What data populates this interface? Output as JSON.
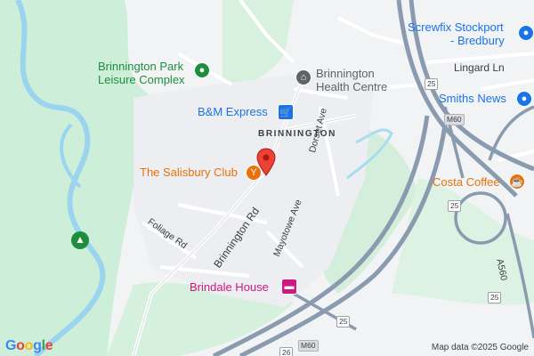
{
  "map": {
    "pois": {
      "brinnington_park": {
        "line1": "Brinnington Park",
        "line2": "Leisure Complex",
        "icon": "leisure-icon"
      },
      "health_centre": {
        "line1": "Brinnington",
        "line2": "Health Centre",
        "icon": "hospital-icon"
      },
      "bm_express": {
        "label": "B&M Express",
        "icon": "shopping-cart-icon"
      },
      "salisbury_club": {
        "label": "The Salisbury Club",
        "icon": "cocktail-icon"
      },
      "screwfix": {
        "line1": "Screwfix Stockport",
        "line2": "- Bredbury",
        "icon": "shopping-bag-icon"
      },
      "smiths_news": {
        "label": "Smiths News",
        "icon": "shopping-bag-icon"
      },
      "costa": {
        "label": "Costa Coffee",
        "icon": "coffee-icon"
      },
      "brindale_house": {
        "label": "Brindale House",
        "icon": "hotel-icon"
      }
    },
    "streets": {
      "lingard_ln": "Lingard Ln",
      "dorset_ave": "Dorset Ave",
      "mayotowe_ave": "Mayotowe Ave",
      "foliage_rd": "Foliage Rd",
      "brinnington_rd": "Brinnington Rd",
      "a560": "A560"
    },
    "area_label": "BRINNINGTON",
    "shields": {
      "m60_a": "M60",
      "m60_b": "M60",
      "j25_a": "25",
      "j25_b": "25",
      "j25_c": "25",
      "j25_d": "25",
      "j26": "26"
    },
    "park_icon": "park-tree-icon",
    "marker_icon": "location-pin-icon"
  },
  "footer": {
    "logo_letters": [
      "G",
      "o",
      "o",
      "g",
      "l",
      "e"
    ],
    "attribution": "Map data ©2025 Google"
  },
  "colors": {
    "park": "#cdeed8",
    "water": "#9ad4ee",
    "motorway": "#8a9bb0",
    "residential": "#eef0f2",
    "marker": "#ea4335"
  }
}
